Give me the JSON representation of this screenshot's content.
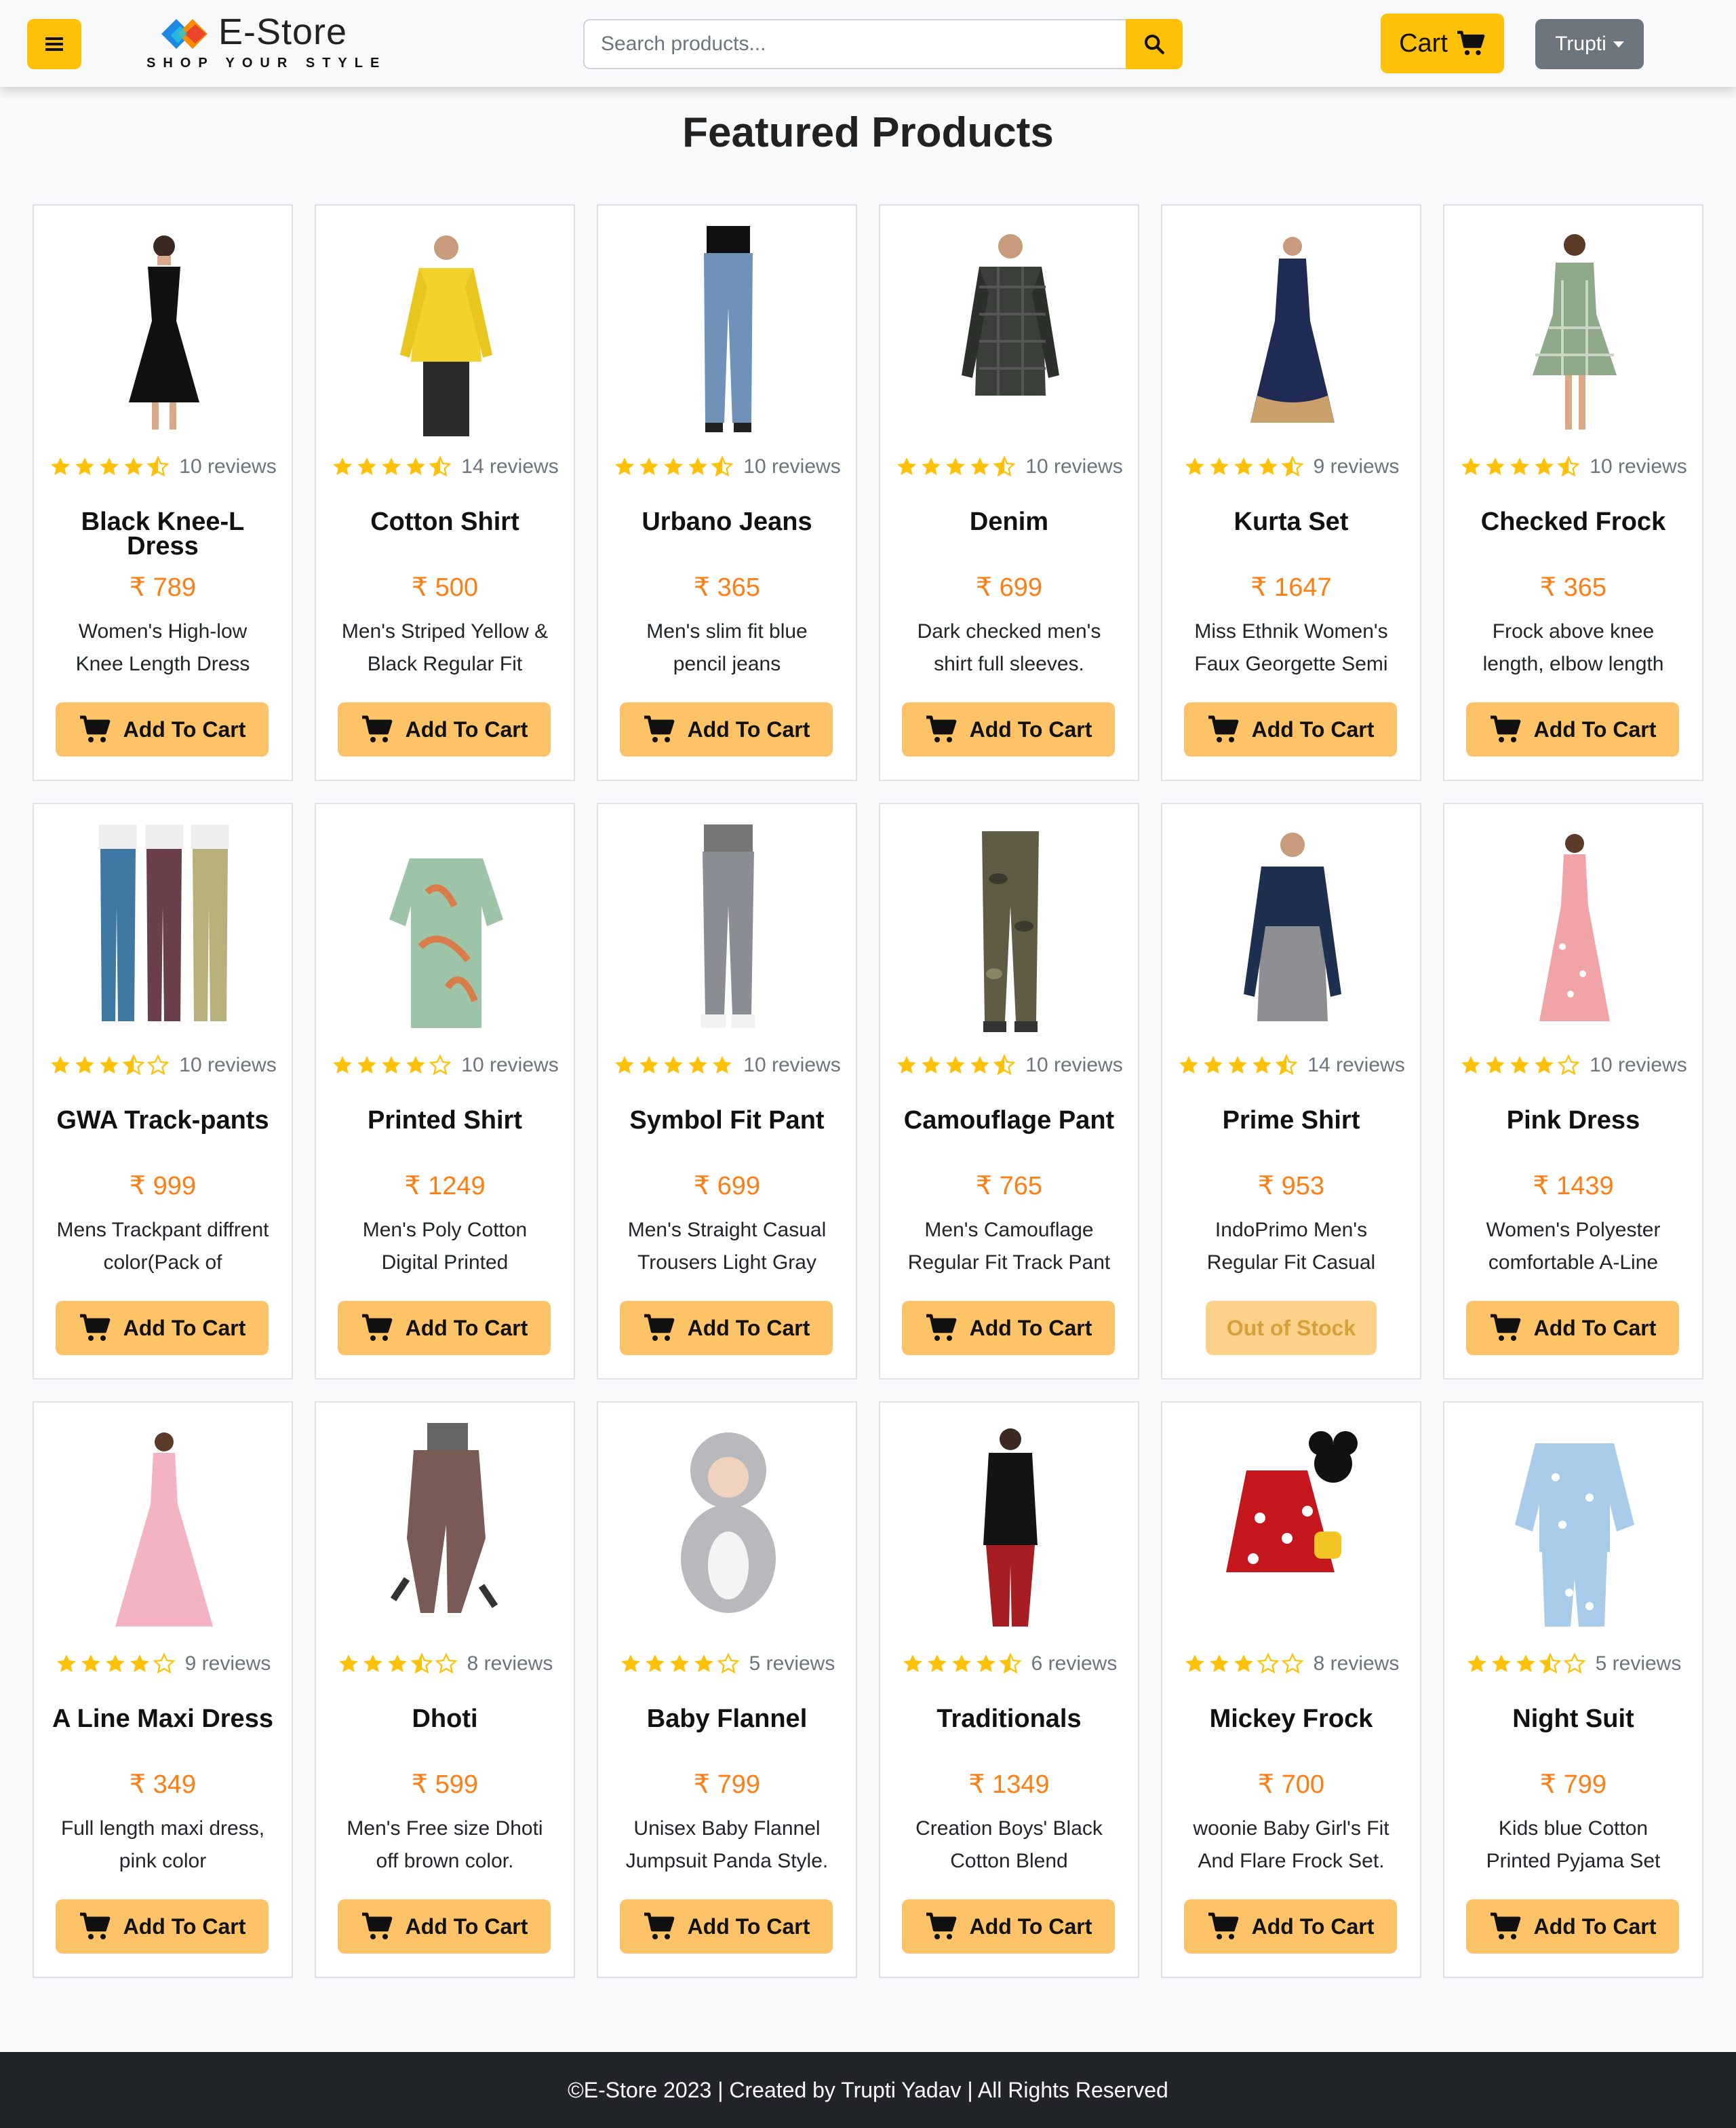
{
  "brand": {
    "name": "E-Store",
    "tagline": "SHOP YOUR STYLE"
  },
  "search": {
    "placeholder": "Search products..."
  },
  "nav": {
    "cart_label": "Cart",
    "user_name": "Trupti"
  },
  "page_title": "Featured Products",
  "colors": {
    "accent": "#ffc107",
    "button": "#fec366",
    "price": "#fd7e14",
    "star": "#ffc107",
    "footer": "#212529"
  },
  "add_label": "Add To Cart",
  "products": [
    {
      "name": "Black Knee-L Dress",
      "price": "₹ 789",
      "description": "Women's High-low Knee Length Dress",
      "rating": 4.5,
      "reviews": "10 reviews",
      "in_stock": true,
      "button_label": "Add To Cart",
      "image": "black-dress-image"
    },
    {
      "name": "Cotton Shirt",
      "price": "₹ 500",
      "description": "Men's Striped Yellow & Black Regular Fit",
      "rating": 4.5,
      "reviews": "14 reviews",
      "in_stock": true,
      "button_label": "Add To Cart",
      "image": "yellow-shirt-image"
    },
    {
      "name": "Urbano Jeans",
      "price": "₹ 365",
      "description": "Men's slim fit blue pencil jeans",
      "rating": 4.5,
      "reviews": "10 reviews",
      "in_stock": true,
      "button_label": "Add To Cart",
      "image": "blue-jeans-image"
    },
    {
      "name": "Denim",
      "price": "₹ 699",
      "description": "Dark checked men's shirt full sleeves.",
      "rating": 4.5,
      "reviews": "10 reviews",
      "in_stock": true,
      "button_label": "Add To Cart",
      "image": "checked-shirt-image"
    },
    {
      "name": "Kurta Set",
      "price": "₹ 1647",
      "description": "Miss Ethnik Women's Faux Georgette Semi",
      "rating": 4.5,
      "reviews": "9 reviews",
      "in_stock": true,
      "button_label": "Add To Cart",
      "image": "kurta-set-image"
    },
    {
      "name": "Checked Frock",
      "price": "₹ 365",
      "description": "Frock above knee length, elbow length",
      "rating": 4.5,
      "reviews": "10 reviews",
      "in_stock": true,
      "button_label": "Add To Cart",
      "image": "checked-frock-image"
    },
    {
      "name": "GWA Track-pants",
      "price": "₹ 999",
      "description": "Mens Trackpant diffrent color(Pack of",
      "rating": 3.5,
      "reviews": "10 reviews",
      "in_stock": true,
      "button_label": "Add To Cart",
      "image": "trackpants-image"
    },
    {
      "name": "Printed Shirt",
      "price": "₹ 1249",
      "description": "Men's Poly Cotton Digital Printed",
      "rating": 4,
      "reviews": "10 reviews",
      "in_stock": true,
      "button_label": "Add To Cart",
      "image": "printed-shirt-image"
    },
    {
      "name": "Symbol Fit Pant",
      "price": "₹ 699",
      "description": "Men's Straight Casual Trousers Light Gray",
      "rating": 5,
      "reviews": "10 reviews",
      "in_stock": true,
      "button_label": "Add To Cart",
      "image": "gray-pant-image"
    },
    {
      "name": "Camouflage Pant",
      "price": "₹ 765",
      "description": "Men's Camouflage Regular Fit Track Pant",
      "rating": 4.5,
      "reviews": "10 reviews",
      "in_stock": true,
      "button_label": "Add To Cart",
      "image": "camouflage-pant-image"
    },
    {
      "name": "Prime Shirt",
      "price": "₹ 953",
      "description": "IndoPrimo Men's Regular Fit Casual",
      "rating": 4.5,
      "reviews": "14 reviews",
      "in_stock": false,
      "button_label": "Out of Stock",
      "image": "prime-shirt-image"
    },
    {
      "name": "Pink Dress",
      "price": "₹ 1439",
      "description": "Women's Polyester comfortable A-Line",
      "rating": 4,
      "reviews": "10 reviews",
      "in_stock": true,
      "button_label": "Add To Cart",
      "image": "pink-dress-image"
    },
    {
      "name": "A Line Maxi Dress",
      "price": "₹ 349",
      "description": "Full length maxi dress, pink color",
      "rating": 4,
      "reviews": "9 reviews",
      "in_stock": true,
      "button_label": "Add To Cart",
      "image": "maxi-dress-image"
    },
    {
      "name": "Dhoti",
      "price": "₹ 599",
      "description": "Men's Free size Dhoti off brown color.",
      "rating": 3.5,
      "reviews": "8 reviews",
      "in_stock": true,
      "button_label": "Add To Cart",
      "image": "dhoti-image"
    },
    {
      "name": "Baby Flannel",
      "price": "₹ 799",
      "description": "Unisex Baby Flannel Jumpsuit Panda Style.",
      "rating": 4,
      "reviews": "5 reviews",
      "in_stock": true,
      "button_label": "Add To Cart",
      "image": "baby-flannel-image"
    },
    {
      "name": "Traditionals",
      "price": "₹ 1349",
      "description": "Creation Boys' Black Cotton Blend",
      "rating": 4.5,
      "reviews": "6 reviews",
      "in_stock": true,
      "button_label": "Add To Cart",
      "image": "traditional-kurta-image"
    },
    {
      "name": "Mickey Frock",
      "price": "₹ 700",
      "description": "woonie Baby Girl's Fit And Flare Frock Set.",
      "rating": 3,
      "reviews": "8 reviews",
      "in_stock": true,
      "button_label": "Add To Cart",
      "image": "mickey-frock-image"
    },
    {
      "name": "Night Suit",
      "price": "₹ 799",
      "description": "Kids blue Cotton Printed Pyjama Set",
      "rating": 3.5,
      "reviews": "5 reviews",
      "in_stock": true,
      "button_label": "Add To Cart",
      "image": "night-suit-image"
    }
  ],
  "footer": {
    "text": "©E-Store 2023 | Created by Trupti Yadav | All Rights Reserved"
  }
}
